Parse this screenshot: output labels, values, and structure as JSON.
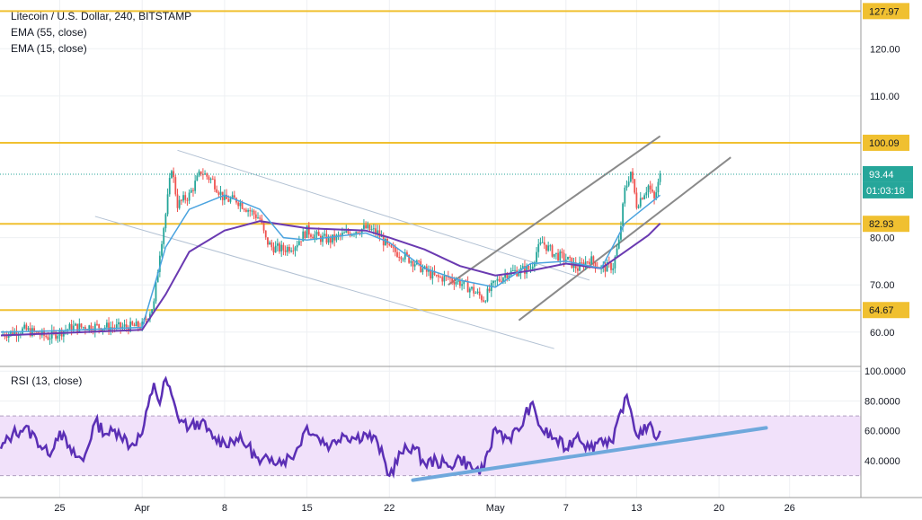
{
  "chart_data": [
    {
      "type": "candlestick",
      "legend": [
        "Litecoin / U.S. Dollar, 240, BITSTAMP",
        "EMA (55, close)",
        "EMA (15, close)"
      ],
      "ylim": [
        55,
        130
      ],
      "y_ticks": [
        "120.00",
        "110.00",
        "80.00",
        "70.00",
        "60.00"
      ],
      "y_tick_values": [
        120,
        110,
        80,
        70,
        60
      ],
      "x_ticks": [
        "25",
        "Apr",
        "8",
        "15",
        "22",
        "May",
        "7",
        "13",
        "20",
        "26"
      ],
      "x_tick_dates": [
        "2019-03-25",
        "2019-04-01",
        "2019-04-08",
        "2019-04-15",
        "2019-04-22",
        "2019-05-01",
        "2019-05-07",
        "2019-05-13",
        "2019-05-20",
        "2019-05-26"
      ],
      "horizontal_levels": [
        {
          "label": "127.97",
          "value": 127.97
        },
        {
          "label": "100.09",
          "value": 100.09
        },
        {
          "label": "82.93",
          "value": 82.93
        },
        {
          "label": "64.67",
          "value": 64.67
        }
      ],
      "last_price": {
        "label": "93.44",
        "value": 93.44,
        "countdown": "01:03:18"
      },
      "price_path": [
        [
          "2019-03-20",
          59.5
        ],
        [
          "2019-03-22",
          60.5
        ],
        [
          "2019-03-24",
          59.0
        ],
        [
          "2019-03-26",
          61.0
        ],
        [
          "2019-03-28",
          61.2
        ],
        [
          "2019-03-30",
          61.0
        ],
        [
          "2019-04-01",
          61.3
        ],
        [
          "2019-04-02",
          66.0
        ],
        [
          "2019-04-02 12:00",
          77.0
        ],
        [
          "2019-04-03",
          85.0
        ],
        [
          "2019-04-03 12:00",
          95.0
        ],
        [
          "2019-04-04",
          87.0
        ],
        [
          "2019-04-05",
          89.0
        ],
        [
          "2019-04-06",
          94.0
        ],
        [
          "2019-04-07",
          92.0
        ],
        [
          "2019-04-08",
          88.0
        ],
        [
          "2019-04-09",
          88.0
        ],
        [
          "2019-04-10",
          86.0
        ],
        [
          "2019-04-11",
          84.0
        ],
        [
          "2019-04-11 12:00",
          79.5
        ],
        [
          "2019-04-12",
          78.0
        ],
        [
          "2019-04-13",
          77.5
        ],
        [
          "2019-04-14",
          78.5
        ],
        [
          "2019-04-15",
          81.5
        ],
        [
          "2019-04-16",
          80.0
        ],
        [
          "2019-04-17",
          79.5
        ],
        [
          "2019-04-18",
          80.5
        ],
        [
          "2019-04-19",
          81.5
        ],
        [
          "2019-04-20",
          82.0
        ],
        [
          "2019-04-21",
          81.0
        ],
        [
          "2019-04-22",
          77.5
        ],
        [
          "2019-04-23",
          76.5
        ],
        [
          "2019-04-24",
          75.0
        ],
        [
          "2019-04-25",
          73.0
        ],
        [
          "2019-04-26",
          71.5
        ],
        [
          "2019-04-27",
          71.5
        ],
        [
          "2019-04-28",
          70.5
        ],
        [
          "2019-04-29",
          69.0
        ],
        [
          "2019-04-30",
          67.0
        ],
        [
          "2019-05-01",
          70.5
        ],
        [
          "2019-05-02",
          72.5
        ],
        [
          "2019-05-03",
          73.0
        ],
        [
          "2019-05-04",
          73.5
        ],
        [
          "2019-05-04 12:00",
          77.0
        ],
        [
          "2019-05-05",
          79.0
        ],
        [
          "2019-05-06",
          76.5
        ],
        [
          "2019-05-07",
          75.5
        ],
        [
          "2019-05-08",
          73.5
        ],
        [
          "2019-05-09",
          75.5
        ],
        [
          "2019-05-10",
          73.5
        ],
        [
          "2019-05-11",
          74.0
        ],
        [
          "2019-05-11 12:00",
          79.0
        ],
        [
          "2019-05-12",
          90.0
        ],
        [
          "2019-05-12 12:00",
          94.0
        ],
        [
          "2019-05-13",
          87.0
        ],
        [
          "2019-05-14",
          91.0
        ],
        [
          "2019-05-14 12:00",
          88.0
        ],
        [
          "2019-05-15",
          93.0
        ]
      ],
      "ema_55_path": [
        [
          "2019-03-20",
          59.3
        ],
        [
          "2019-03-25",
          59.8
        ],
        [
          "2019-04-01",
          60.5
        ],
        [
          "2019-04-03",
          68.0
        ],
        [
          "2019-04-05",
          77.0
        ],
        [
          "2019-04-08",
          81.5
        ],
        [
          "2019-04-11",
          83.5
        ],
        [
          "2019-04-15",
          82.0
        ],
        [
          "2019-04-20",
          81.5
        ],
        [
          "2019-04-22",
          80.0
        ],
        [
          "2019-04-25",
          77.5
        ],
        [
          "2019-04-28",
          74.0
        ],
        [
          "2019-05-01",
          72.0
        ],
        [
          "2019-05-04",
          73.0
        ],
        [
          "2019-05-07",
          74.5
        ],
        [
          "2019-05-10",
          73.5
        ],
        [
          "2019-05-12",
          77.0
        ],
        [
          "2019-05-14",
          80.5
        ],
        [
          "2019-05-15",
          83.0
        ]
      ],
      "ema_15_path": [
        [
          "2019-03-20",
          60.0
        ],
        [
          "2019-03-25",
          60.3
        ],
        [
          "2019-04-01",
          61.0
        ],
        [
          "2019-04-03",
          78.0
        ],
        [
          "2019-04-05",
          86.0
        ],
        [
          "2019-04-08",
          89.0
        ],
        [
          "2019-04-11",
          86.0
        ],
        [
          "2019-04-13",
          80.0
        ],
        [
          "2019-04-15",
          79.5
        ],
        [
          "2019-04-20",
          81.0
        ],
        [
          "2019-04-22",
          79.0
        ],
        [
          "2019-04-25",
          73.5
        ],
        [
          "2019-04-28",
          71.0
        ],
        [
          "2019-05-01",
          69.5
        ],
        [
          "2019-05-04",
          74.5
        ],
        [
          "2019-05-07",
          75.0
        ],
        [
          "2019-05-10",
          73.5
        ],
        [
          "2019-05-12",
          83.0
        ],
        [
          "2019-05-13",
          85.0
        ],
        [
          "2019-05-15",
          89.0
        ]
      ],
      "trend_lines": [
        {
          "from": [
            "2019-04-04",
            98.5
          ],
          "to": [
            "2019-05-09",
            71.0
          ],
          "color": "#b2c1d3"
        },
        {
          "from": [
            "2019-03-28",
            84.5
          ],
          "to": [
            "2019-05-06",
            56.5
          ],
          "color": "#b2c1d3"
        },
        {
          "from": [
            "2019-04-27",
            70.0
          ],
          "to": [
            "2019-05-15",
            101.5
          ],
          "color": "#8a8a8a"
        },
        {
          "from": [
            "2019-05-03",
            62.5
          ],
          "to": [
            "2019-05-21",
            97.0
          ],
          "color": "#8a8a8a"
        }
      ],
      "colors": {
        "up": "#26a69a",
        "down": "#ef5350",
        "ema55": "#6a3ab1",
        "ema15": "#4aa3df",
        "level": "#f0c030",
        "last": "#26a69a"
      }
    },
    {
      "type": "line",
      "legend": [
        "RSI (13, close)"
      ],
      "ylim": [
        22,
        102
      ],
      "y_ticks": [
        "100.0000",
        "80.0000",
        "60.0000",
        "40.0000"
      ],
      "y_tick_values": [
        100,
        80,
        60,
        40
      ],
      "band": [
        30,
        70
      ],
      "rsi_path": [
        [
          "2019-03-20",
          48
        ],
        [
          "2019-03-21",
          58
        ],
        [
          "2019-03-22",
          62
        ],
        [
          "2019-03-23",
          55
        ],
        [
          "2019-03-24",
          44
        ],
        [
          "2019-03-25",
          60
        ],
        [
          "2019-03-26",
          45
        ],
        [
          "2019-03-27",
          40
        ],
        [
          "2019-03-28",
          66
        ],
        [
          "2019-03-29",
          58
        ],
        [
          "2019-03-30",
          60
        ],
        [
          "2019-03-31",
          50
        ],
        [
          "2019-04-01",
          58
        ],
        [
          "2019-04-02",
          92
        ],
        [
          "2019-04-02 12:00",
          78
        ],
        [
          "2019-04-03",
          95
        ],
        [
          "2019-04-04",
          70
        ],
        [
          "2019-04-05",
          62
        ],
        [
          "2019-04-06",
          66
        ],
        [
          "2019-04-07",
          55
        ],
        [
          "2019-04-08",
          52
        ],
        [
          "2019-04-09",
          55
        ],
        [
          "2019-04-10",
          50
        ],
        [
          "2019-04-11",
          38
        ],
        [
          "2019-04-12",
          42
        ],
        [
          "2019-04-13",
          40
        ],
        [
          "2019-04-14",
          45
        ],
        [
          "2019-04-15",
          63
        ],
        [
          "2019-04-16",
          55
        ],
        [
          "2019-04-17",
          50
        ],
        [
          "2019-04-18",
          58
        ],
        [
          "2019-04-19",
          55
        ],
        [
          "2019-04-20",
          58
        ],
        [
          "2019-04-21",
          52
        ],
        [
          "2019-04-22",
          30
        ],
        [
          "2019-04-23",
          45
        ],
        [
          "2019-04-24",
          50
        ],
        [
          "2019-04-25",
          38
        ],
        [
          "2019-04-26",
          40
        ],
        [
          "2019-04-27",
          36
        ],
        [
          "2019-04-28",
          42
        ],
        [
          "2019-04-29",
          35
        ],
        [
          "2019-04-30",
          33
        ],
        [
          "2019-05-01",
          62
        ],
        [
          "2019-05-02",
          55
        ],
        [
          "2019-05-03",
          60
        ],
        [
          "2019-05-04",
          78
        ],
        [
          "2019-05-05",
          60
        ],
        [
          "2019-05-06",
          55
        ],
        [
          "2019-05-07",
          48
        ],
        [
          "2019-05-08",
          58
        ],
        [
          "2019-05-09",
          48
        ],
        [
          "2019-05-10",
          55
        ],
        [
          "2019-05-11",
          52
        ],
        [
          "2019-05-12",
          82
        ],
        [
          "2019-05-12 12:00",
          74
        ],
        [
          "2019-05-13",
          57
        ],
        [
          "2019-05-14",
          64
        ],
        [
          "2019-05-14 12:00",
          56
        ],
        [
          "2019-05-15",
          60
        ]
      ],
      "trend_line": {
        "from": [
          "2019-04-24",
          27.0
        ],
        "to": [
          "2019-05-24",
          62.0
        ],
        "color": "#6fa8dc"
      },
      "colors": {
        "rsi": "#5b2fb5",
        "band_fill": "#f1e1fa",
        "band_line": "#b0a0c0"
      }
    }
  ]
}
